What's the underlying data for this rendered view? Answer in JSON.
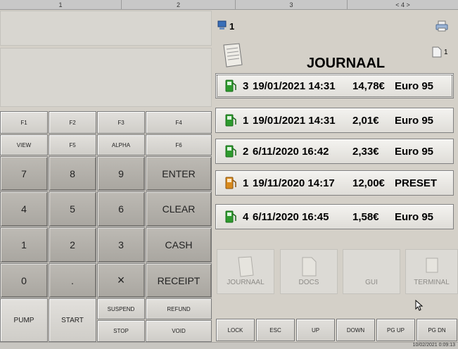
{
  "ruler": [
    "1",
    "2",
    "3",
    "< 4 >"
  ],
  "header": {
    "terminal_num": "1",
    "title": "JOURNAAL",
    "doc_count": "1"
  },
  "keypad": {
    "f1": "F1",
    "f2": "F2",
    "f3": "F3",
    "f4": "F4",
    "view": "VIEW",
    "f5": "F5",
    "alpha": "ALPHA",
    "f6": "F6",
    "k7": "7",
    "k8": "8",
    "k9": "9",
    "enter": "ENTER",
    "k4": "4",
    "k5": "5",
    "k6": "6",
    "clear": "CLEAR",
    "k1": "1",
    "k2": "2",
    "k3": "3",
    "cash": "CASH",
    "k0": "0",
    "dot": ".",
    "times": "×",
    "receipt": "RECEIPT",
    "pump": "PUMP",
    "start": "START",
    "suspend": "SUSPEND",
    "refund": "REFUND",
    "stop": "STOP",
    "void": "VOID"
  },
  "journal": [
    {
      "pump": "3",
      "datetime": "19/01/2021 14:31",
      "amount": "14,78€",
      "grade": "Euro 95",
      "icon": "fuel-pump-green-icon"
    },
    {
      "pump": "1",
      "datetime": "19/01/2021 14:31",
      "amount": "2,01€",
      "grade": "Euro 95",
      "icon": "fuel-pump-green-icon"
    },
    {
      "pump": "2",
      "datetime": "6/11/2020 16:42",
      "amount": "2,33€",
      "grade": "Euro 95",
      "icon": "fuel-pump-green-icon"
    },
    {
      "pump": "1",
      "datetime": "19/11/2020 14:17",
      "amount": "12,00€",
      "grade": "PRESET",
      "icon": "fuel-pump-orange-icon"
    },
    {
      "pump": "4",
      "datetime": "6/11/2020 16:45",
      "amount": "1,58€",
      "grade": "Euro 95",
      "icon": "fuel-pump-green-icon"
    }
  ],
  "tiles": {
    "journaal": "JOURNAAL",
    "docs": "DOCS",
    "gui": "GUI",
    "terminal": "TERMINAL"
  },
  "nav": {
    "lock": "LOCK",
    "esc": "ESC",
    "up": "UP",
    "down": "DOWN",
    "pgup": "PG UP",
    "pgdn": "PG DN"
  },
  "status": {
    "timestamp": "10/02/2021 0:09:13"
  },
  "colors": {
    "fuel_green": "#2e9b2e",
    "fuel_orange": "#d98a1c"
  }
}
